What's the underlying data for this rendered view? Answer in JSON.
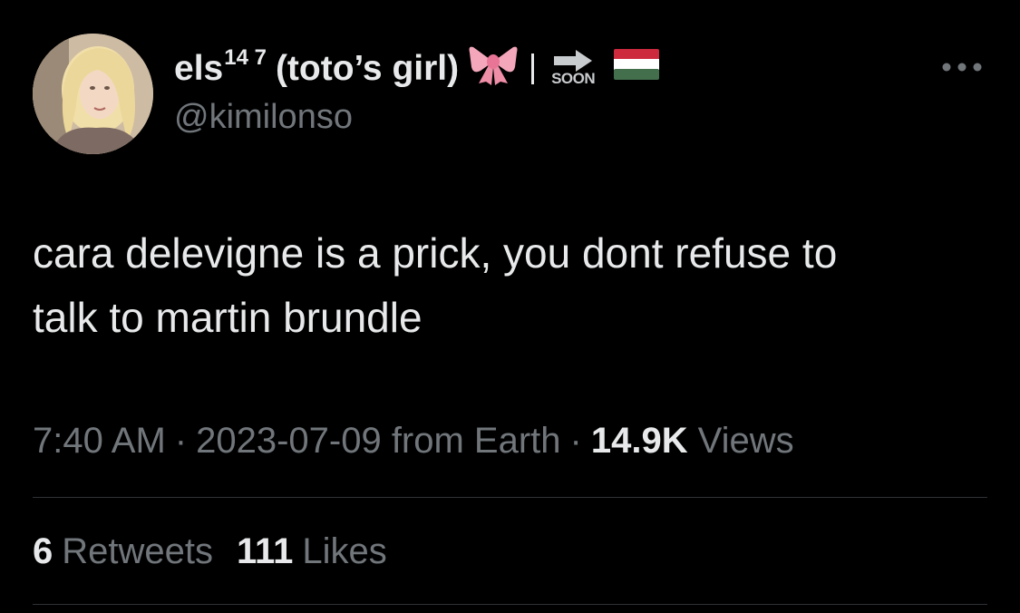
{
  "author": {
    "name": "els",
    "name_superscript": "14 7",
    "name_suffix": "(toto’s girl)",
    "bow_emoji": "🎀",
    "soon_label": "SOON",
    "handle": "@kimilonso"
  },
  "icons": {
    "more": "more-horizontal-icon",
    "bow": "ribbon-bow-emoji",
    "soon": "soon-arrow-emoji",
    "flag": "hungary-flag-emoji"
  },
  "tweet": {
    "text": "cara delevigne is a prick, you dont refuse to\ntalk to martin brundle"
  },
  "meta": {
    "time": "7:40 AM",
    "separator": "·",
    "date": "2023-07-09 from Earth",
    "views_count": "14.9K",
    "views_label": "Views"
  },
  "stats": {
    "retweets_count": "6",
    "retweets_label": "Retweets",
    "likes_count": "111",
    "likes_label": "Likes"
  },
  "colors": {
    "background": "#000000",
    "text_primary": "#e7e9ea",
    "text_secondary": "#71767b",
    "divider": "#2f3336",
    "flag_red": "#cd2a3e",
    "flag_white": "#ffffff",
    "flag_green": "#436f4d"
  }
}
